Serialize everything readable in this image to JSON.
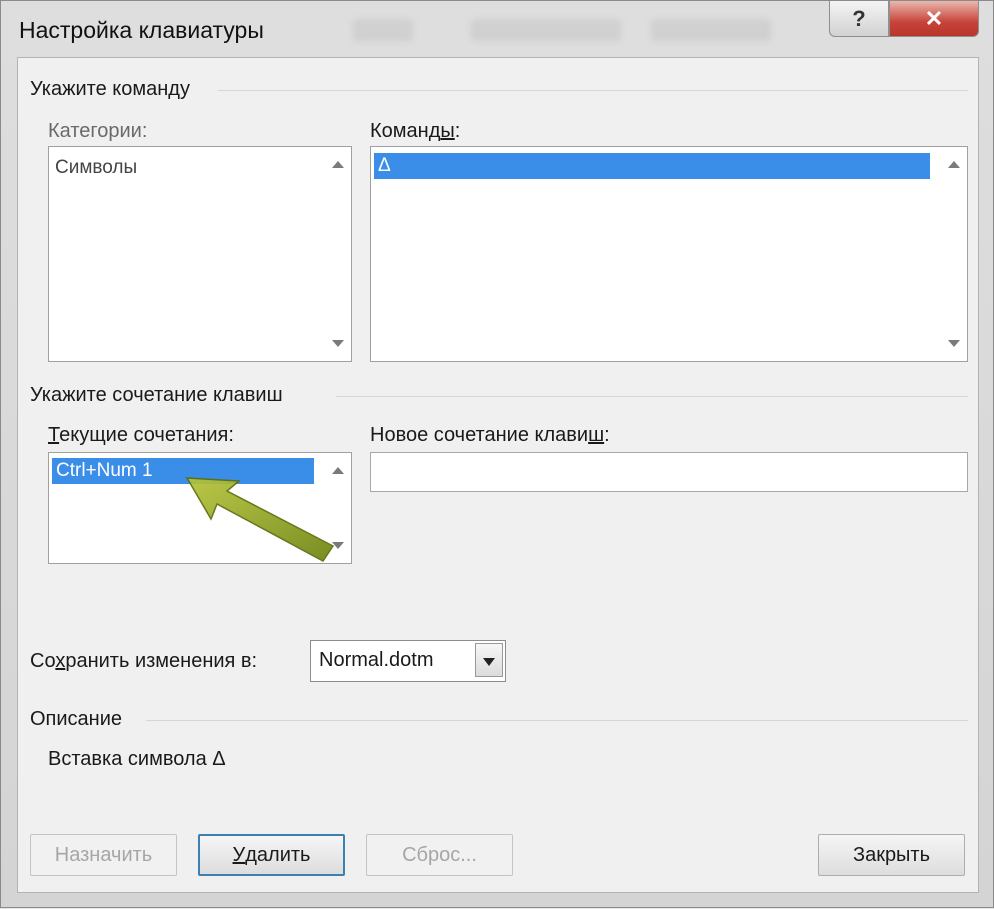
{
  "window": {
    "title": "Настройка клавиатуры",
    "help_glyph": "?",
    "close_glyph": "✕"
  },
  "command_section": {
    "heading": "Укажите команду",
    "categories_label": "Категории:",
    "categories_items": [
      "Символы"
    ],
    "commands_label": "Команды:",
    "commands_items": [
      "Δ"
    ]
  },
  "shortcut_section": {
    "heading": "Укажите сочетание клавиш",
    "current_label": "Текущие сочетания:",
    "current_items": [
      "Ctrl+Num 1"
    ],
    "new_label": "Новое сочетание клавиш:",
    "new_value": ""
  },
  "save": {
    "label": "Сохранить изменения в:",
    "value": "Normal.dotm"
  },
  "description": {
    "heading": "Описание",
    "text": "Вставка символа Δ"
  },
  "buttons": {
    "assign": "Назначить",
    "remove": "Удалить",
    "reset": "Сброс...",
    "close": "Закрыть"
  },
  "colors": {
    "selection": "#3b8ee8",
    "annotation_arrow": "#8fa31c"
  },
  "icons": [
    "help-icon",
    "close-icon",
    "scroll-up-icon",
    "scroll-down-icon",
    "dropdown-arrow-icon",
    "annotation-arrow"
  ]
}
